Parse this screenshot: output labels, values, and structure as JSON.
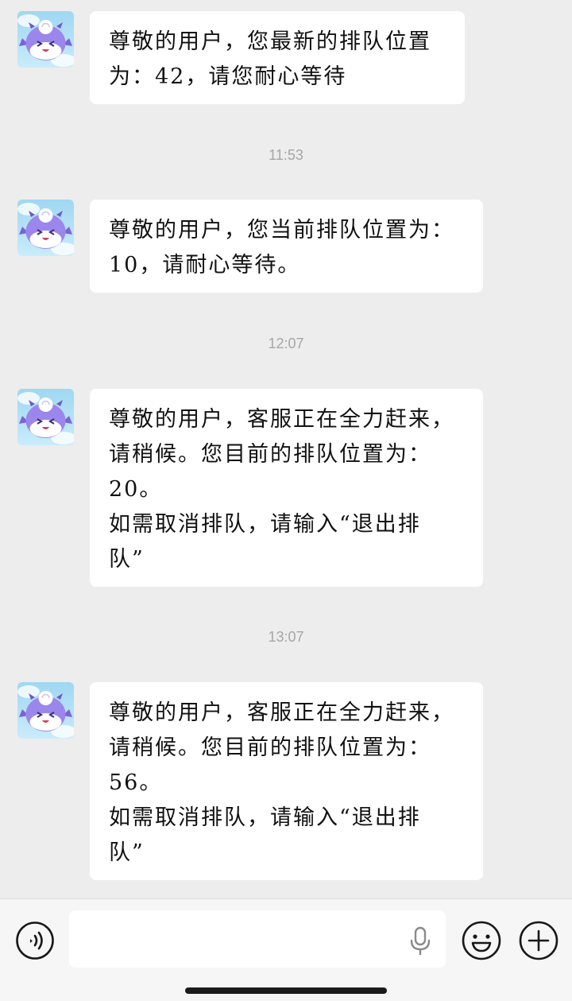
{
  "messages": [
    {
      "avatar_icon": "purple-monster-avatar-icon",
      "lines": [
        "尊敬的用户，您最新的排队位置",
        "为：42，请您耐心等待"
      ]
    },
    {
      "avatar_icon": "purple-monster-avatar-icon",
      "lines": [
        "尊敬的用户，您当前排队位置为：",
        "10，请耐心等待。"
      ]
    },
    {
      "avatar_icon": "purple-monster-avatar-icon",
      "lines": [
        "尊敬的用户，客服正在全力赶来，",
        "请稍候。您目前的排队位置为：",
        "20。",
        "如需取消排队，请输入“退出排",
        "队”"
      ]
    },
    {
      "avatar_icon": "purple-monster-avatar-icon",
      "lines": [
        "尊敬的用户，客服正在全力赶来，",
        "请稍候。您目前的排队位置为：",
        "56。",
        "如需取消排队，请输入“退出排",
        "队”"
      ]
    }
  ],
  "timestamps": [
    "11:53",
    "12:07",
    "13:07"
  ],
  "input_bar": {
    "text_value": "",
    "voice_icon": "voice-mode-icon",
    "mic_icon": "microphone-icon",
    "emoji_icon": "emoji-smiley-icon",
    "plus_icon": "plus-icon"
  },
  "colors": {
    "background": "#ededed",
    "bubble": "#ffffff",
    "timestamp": "#a6a6a6",
    "input_bar": "#f6f6f6"
  }
}
